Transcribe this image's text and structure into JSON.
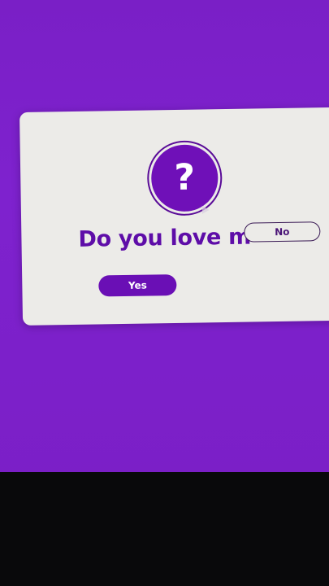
{
  "dialog": {
    "icon": "question-mark-icon",
    "icon_glyph": "?",
    "question": "Do you love m",
    "no_label": "No",
    "yes_label": "Yes"
  },
  "colors": {
    "background": "#7e22ce",
    "card": "#ecebe8",
    "accent": "#6a0fb5",
    "text": "#5e0da8"
  }
}
